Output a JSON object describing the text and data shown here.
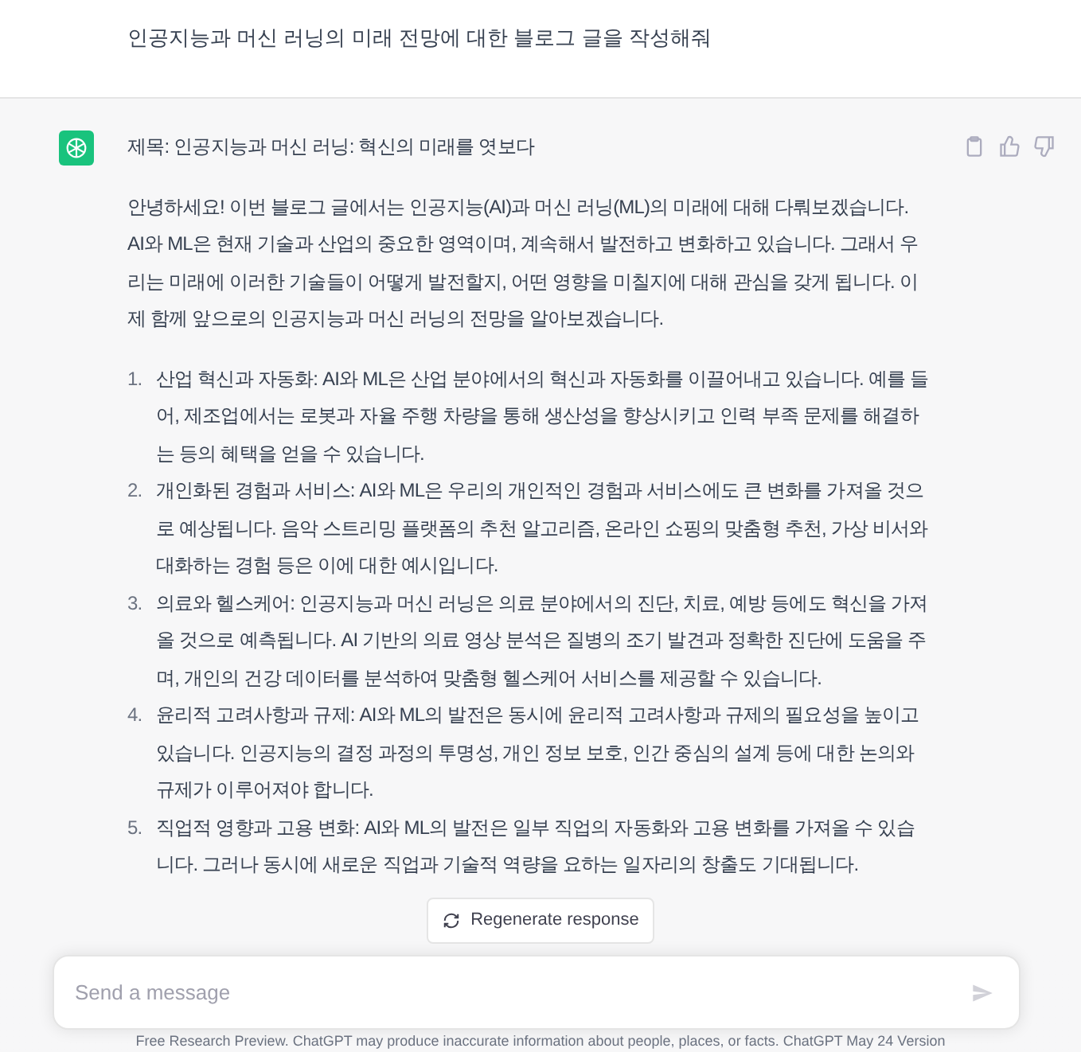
{
  "user_message": {
    "text": "인공지능과 머신 러닝의 미래 전망에 대한 블로그 글을 작성해줘"
  },
  "assistant_message": {
    "title": "제목: 인공지능과 머신 러닝: 혁신의 미래를 엿보다",
    "intro": "안녕하세요! 이번 블로그 글에서는 인공지능(AI)과 머신 러닝(ML)의 미래에 대해 다뤄보겠습니다. AI와 ML은 현재 기술과 산업의 중요한 영역이며, 계속해서 발전하고 변화하고 있습니다. 그래서 우리는 미래에 이러한 기술들이 어떻게 발전할지, 어떤 영향을 미칠지에 대해 관심을 갖게 됩니다. 이제 함께 앞으로의 인공지능과 머신 러닝의 전망을 알아보겠습니다.",
    "list": [
      {
        "number": "1.",
        "text": "산업 혁신과 자동화: AI와 ML은 산업 분야에서의 혁신과 자동화를 이끌어내고 있습니다. 예를 들어, 제조업에서는 로봇과 자율 주행 차량을 통해 생산성을 향상시키고 인력 부족 문제를 해결하는 등의 혜택을 얻을 수 있습니다."
      },
      {
        "number": "2.",
        "text": "개인화된 경험과 서비스: AI와 ML은 우리의 개인적인 경험과 서비스에도 큰 변화를 가져올 것으로 예상됩니다. 음악 스트리밍 플랫폼의 추천 알고리즘, 온라인 쇼핑의 맞춤형 추천, 가상 비서와 대화하는 경험 등은 이에 대한 예시입니다."
      },
      {
        "number": "3.",
        "text": "의료와 헬스케어: 인공지능과 머신 러닝은 의료 분야에서의 진단, 치료, 예방 등에도 혁신을 가져올 것으로 예측됩니다. AI 기반의 의료 영상 분석은 질병의 조기 발견과 정확한 진단에 도움을 주며, 개인의 건강 데이터를 분석하여 맞춤형 헬스케어 서비스를 제공할 수 있습니다."
      },
      {
        "number": "4.",
        "text": "윤리적 고려사항과 규제: AI와 ML의 발전은 동시에 윤리적 고려사항과 규제의 필요성을 높이고 있습니다. 인공지능의 결정 과정의 투명성, 개인 정보 보호, 인간 중심의 설계 등에 대한 논의와 규제가 이루어져야 합니다."
      },
      {
        "number": "5.",
        "text": "직업적 영향과 고용 변화: AI와 ML의 발전은 일부 직업의 자동화와 고용 변화를 가져올 수 있습니다. 그러나 동시에 새로운 직업과 기술적 역량을 요하는 일자리의 창출도 기대됩니다."
      }
    ]
  },
  "regenerate_button": {
    "label": "Regenerate response"
  },
  "composer": {
    "placeholder": "Send a message"
  },
  "footer": {
    "text": "Free Research Preview. ChatGPT may produce inaccurate information about people, places, or facts. ChatGPT May 24 Version"
  }
}
